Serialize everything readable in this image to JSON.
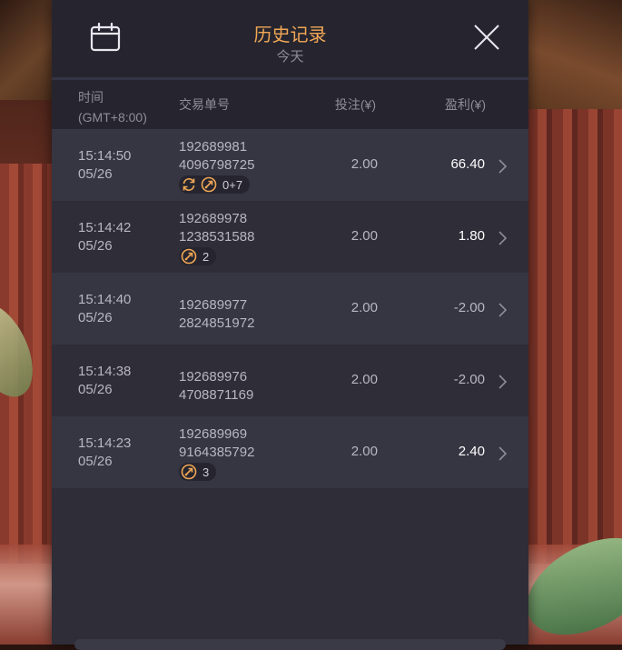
{
  "header": {
    "title": "历史记录",
    "subtitle": "今天"
  },
  "columns": {
    "time_line1": "时间",
    "time_line2": "(GMT+8:00)",
    "order": "交易单号",
    "bet": "投注(¥)",
    "profit": "盈利(¥)"
  },
  "rows": [
    {
      "time": "15:14:50",
      "date": "05/26",
      "order1": "192689981",
      "order2": "4096798725",
      "bet": "2.00",
      "profit": "66.40",
      "profit_sign": "pos",
      "badges": [
        "respin-icon",
        "free-spin-icon"
      ],
      "badge_text": "0+7"
    },
    {
      "time": "15:14:42",
      "date": "05/26",
      "order1": "192689978",
      "order2": "1238531588",
      "bet": "2.00",
      "profit": "1.80",
      "profit_sign": "pos",
      "badges": [
        "free-spin-icon"
      ],
      "badge_text": "2"
    },
    {
      "time": "15:14:40",
      "date": "05/26",
      "order1": "192689977",
      "order2": "2824851972",
      "bet": "2.00",
      "profit": "-2.00",
      "profit_sign": "neg",
      "badges": [],
      "badge_text": ""
    },
    {
      "time": "15:14:38",
      "date": "05/26",
      "order1": "192689976",
      "order2": "4708871169",
      "bet": "2.00",
      "profit": "-2.00",
      "profit_sign": "neg",
      "badges": [],
      "badge_text": ""
    },
    {
      "time": "15:14:23",
      "date": "05/26",
      "order1": "192689969",
      "order2": "9164385792",
      "bet": "2.00",
      "profit": "2.40",
      "profit_sign": "pos",
      "badges": [
        "free-spin-icon"
      ],
      "badge_text": "3"
    }
  ],
  "colors": {
    "accent": "#f0a756",
    "panel": "#2e2d38",
    "row_alt": "#363542",
    "header": "#26252f"
  }
}
